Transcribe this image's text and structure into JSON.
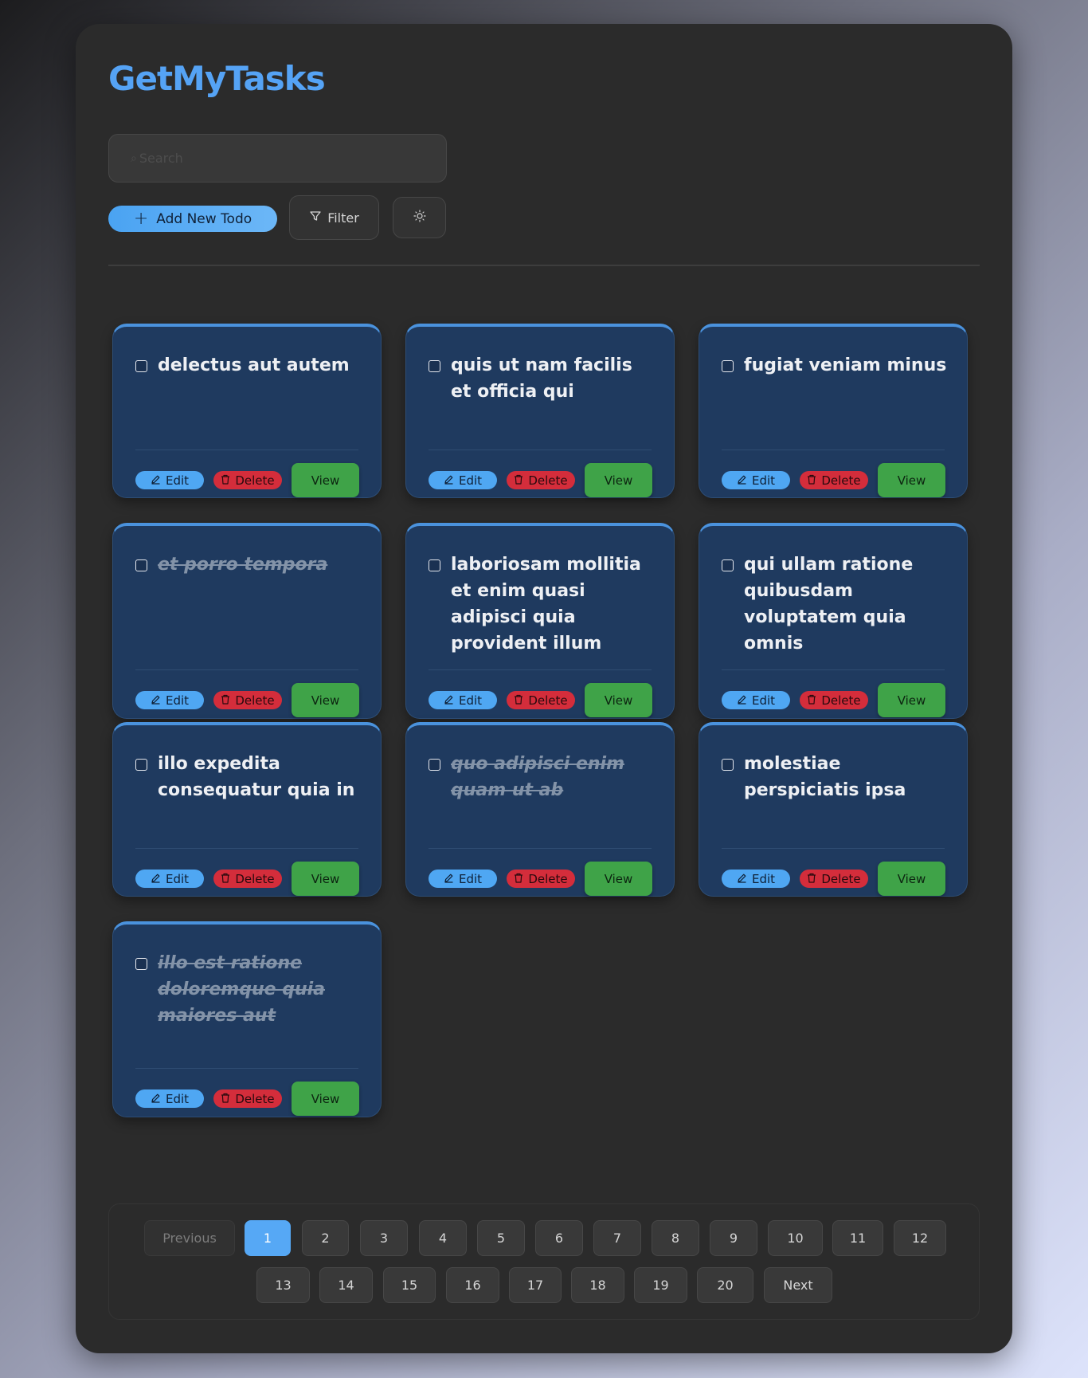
{
  "app": {
    "title": "GetMyTasks"
  },
  "search": {
    "placeholder": "Search",
    "icon": "search-icon"
  },
  "toolbar": {
    "add_label": "Add New Todo",
    "filter_label": "Filter",
    "theme_icon": "sun-icon"
  },
  "colors": {
    "accent": "#55a3f5",
    "card_bg": "#1f3a5f",
    "edit": "#4fa7f3",
    "delete": "#d42d3b",
    "view": "#3fa348"
  },
  "actions": {
    "edit": "Edit",
    "delete": "Delete",
    "view": "View"
  },
  "todos": [
    {
      "title": "delectus aut autem",
      "completed": false
    },
    {
      "title": "quis ut nam facilis et officia qui",
      "completed": false
    },
    {
      "title": "fugiat veniam minus",
      "completed": false
    },
    {
      "title": "et porro tempora",
      "completed": true
    },
    {
      "title": "laboriosam mollitia et enim quasi adipisci quia provident illum",
      "completed": false
    },
    {
      "title": "qui ullam ratione quibusdam voluptatem quia omnis",
      "completed": false
    },
    {
      "title": "illo expedita consequatur quia in",
      "completed": false
    },
    {
      "title": "quo adipisci enim quam ut ab",
      "completed": true
    },
    {
      "title": "molestiae perspiciatis ipsa",
      "completed": false
    },
    {
      "title": "illo est ratione doloremque quia maiores aut",
      "completed": true
    }
  ],
  "pagination": {
    "previous": "Previous",
    "next": "Next",
    "current": "1",
    "pages": [
      "1",
      "2",
      "3",
      "4",
      "5",
      "6",
      "7",
      "8",
      "9",
      "10",
      "11",
      "12",
      "13",
      "14",
      "15",
      "16",
      "17",
      "18",
      "19",
      "20"
    ]
  }
}
